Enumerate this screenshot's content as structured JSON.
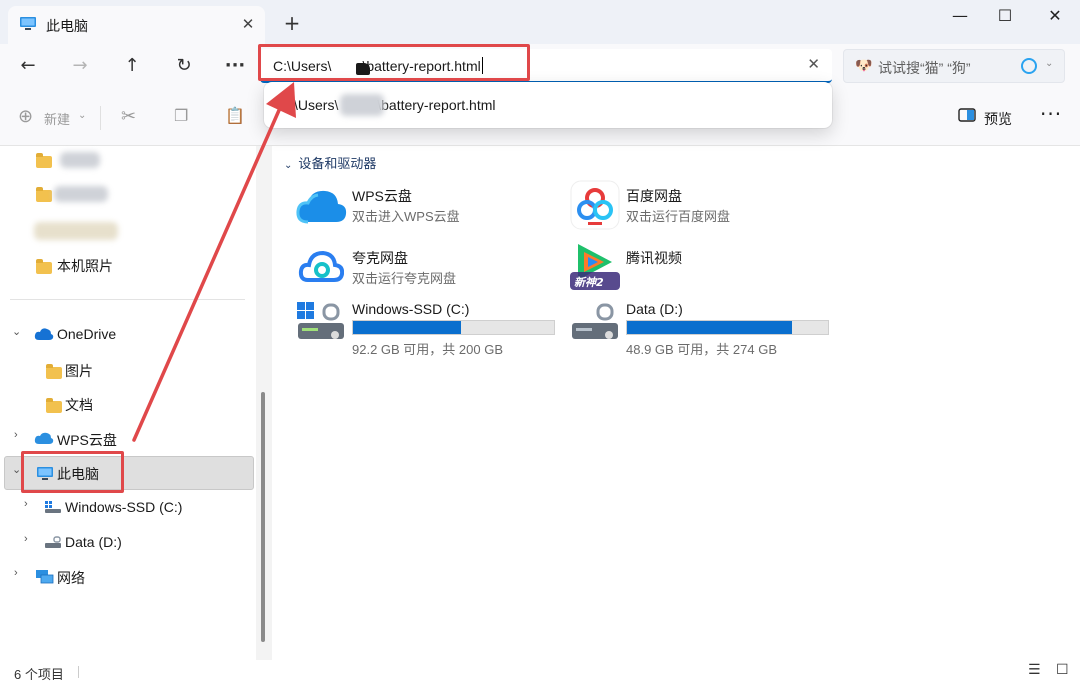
{
  "window": {
    "tab_title": "此电脑",
    "tab_close_icon": "close-icon",
    "new_tab_glyph": "+",
    "minimize_glyph": "—",
    "maximize_glyph": "☐",
    "close_glyph": "✕"
  },
  "nav": {
    "back": "←",
    "forward": "→",
    "up": "↑",
    "refresh": "↻",
    "more": "···",
    "address_value": "C:\\Users\\        \\battery-report.html",
    "address_clear": "✕",
    "search_placeholder": "试试搜“猫”  “狗”",
    "search_icon": "dog-icon"
  },
  "suggestion": {
    "text": "\\Users\\          \\battery-report.html"
  },
  "commands": {
    "new_label": "新建",
    "preview_label": "预览",
    "more_glyph": "···"
  },
  "sidebar": {
    "pictures_local": "本机照片",
    "onedrive": "OneDrive",
    "onedrive_pictures": "图片",
    "onedrive_documents": "文档",
    "wps_cloud": "WPS云盘",
    "this_pc": "此电脑",
    "drive_c": "Windows-SSD (C:)",
    "drive_d": "Data (D:)",
    "network": "网络"
  },
  "main": {
    "section_title": "设备和驱动器",
    "devices": [
      {
        "name": "WPS云盘",
        "sub": "双击进入WPS云盘",
        "icon": "wps-cloud-icon"
      },
      {
        "name": "百度网盘",
        "sub": "双击运行百度网盘",
        "icon": "baidu-netdisk-icon"
      },
      {
        "name": "夸克网盘",
        "sub": "双击运行夸克网盘",
        "icon": "quark-netdisk-icon"
      },
      {
        "name": "腾讯视频",
        "sub": "",
        "icon": "tencent-video-icon"
      }
    ],
    "drives": [
      {
        "name": "Windows-SSD (C:)",
        "free_text": "92.2 GB 可用，共 200 GB",
        "used_fraction": 0.539,
        "icon": "windows-drive-icon"
      },
      {
        "name": "Data (D:)",
        "free_text": "48.9 GB 可用，共 274 GB",
        "used_fraction": 0.822,
        "icon": "data-drive-icon"
      }
    ]
  },
  "status": {
    "item_count": "6 个项目"
  },
  "colors": {
    "accent": "#0067c0",
    "drive_fill": "#0a6fce",
    "highlight": "#e0484a",
    "selected_bg": "#dfdfdf"
  }
}
